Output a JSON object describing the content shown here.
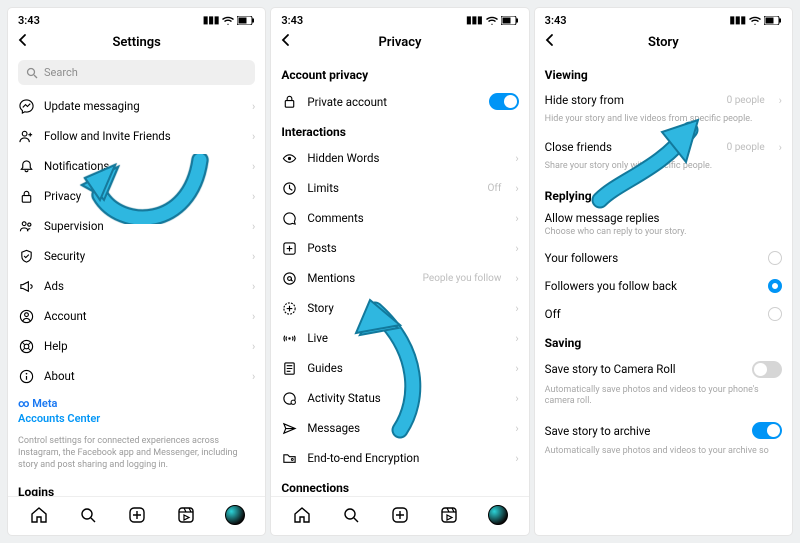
{
  "status": {
    "time": "3:43"
  },
  "panels": {
    "settings": {
      "title": "Settings",
      "search_placeholder": "Search",
      "items": [
        {
          "label": "Update messaging"
        },
        {
          "label": "Follow and Invite Friends"
        },
        {
          "label": "Notifications"
        },
        {
          "label": "Privacy"
        },
        {
          "label": "Supervision"
        },
        {
          "label": "Security"
        },
        {
          "label": "Ads"
        },
        {
          "label": "Account"
        },
        {
          "label": "Help"
        },
        {
          "label": "About"
        }
      ],
      "meta_label": "Meta",
      "accounts_center": "Accounts Center",
      "footer_text": "Control settings for connected experiences across Instagram, the Facebook app and Messenger, including story and post sharing and logging in.",
      "logins_label": "Logins"
    },
    "privacy": {
      "title": "Privacy",
      "section_account": "Account privacy",
      "private_account": "Private account",
      "section_interactions": "Interactions",
      "items": [
        {
          "label": "Hidden Words",
          "val": ""
        },
        {
          "label": "Limits",
          "val": "Off"
        },
        {
          "label": "Comments",
          "val": ""
        },
        {
          "label": "Posts",
          "val": ""
        },
        {
          "label": "Mentions",
          "val": "People you follow"
        },
        {
          "label": "Story",
          "val": ""
        },
        {
          "label": "Live",
          "val": ""
        },
        {
          "label": "Guides",
          "val": ""
        },
        {
          "label": "Activity Status",
          "val": ""
        },
        {
          "label": "Messages",
          "val": ""
        },
        {
          "label": "End-to-end Encryption",
          "val": ""
        }
      ],
      "section_connections": "Connections"
    },
    "story": {
      "title": "Story",
      "section_viewing": "Viewing",
      "hide_from": "Hide story from",
      "hide_from_sub": "Hide your story and live videos from specific people.",
      "hide_from_val": "0 people",
      "close_friends": "Close friends",
      "close_friends_sub": "Share your story only with specific people.",
      "close_friends_val": "0 people",
      "section_replying": "Replying",
      "allow_replies": "Allow message replies",
      "allow_replies_sub": "Choose who can reply to your story.",
      "reply_options": [
        {
          "label": "Your followers",
          "selected": false
        },
        {
          "label": "Followers you follow back",
          "selected": true
        },
        {
          "label": "Off",
          "selected": false
        }
      ],
      "section_saving": "Saving",
      "save_camera": "Save story to Camera Roll",
      "save_camera_sub": "Automatically save photos and videos to your phone's camera roll.",
      "save_archive": "Save story to archive",
      "save_archive_sub": "Automatically save photos and videos to your archive so"
    }
  },
  "arrow_color": "#2fb7e0"
}
